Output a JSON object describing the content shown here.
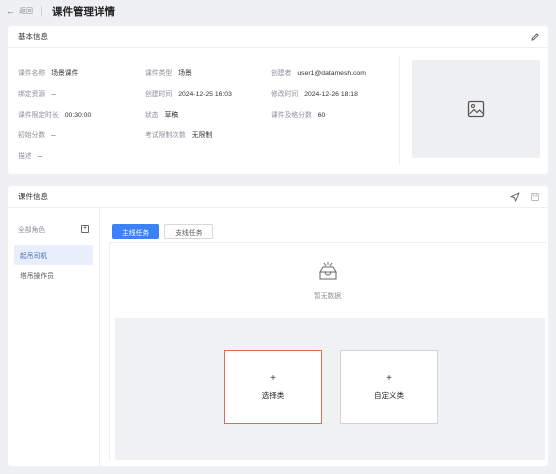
{
  "header": {
    "back_label": "返回",
    "title": "课件管理详情"
  },
  "basic": {
    "title": "基本信息",
    "fields": {
      "name": {
        "k": "课件名称",
        "v": "场景课件"
      },
      "type": {
        "k": "课件类型",
        "v": "场景"
      },
      "creator": {
        "k": "创建者",
        "v": "user1@datamesh.com"
      },
      "bind": {
        "k": "绑定资源",
        "v": "--"
      },
      "created": {
        "k": "创建时间",
        "v": "2024-12-25 16:03"
      },
      "modified": {
        "k": "修改时间",
        "v": "2024-12-26 18:18"
      },
      "duration": {
        "k": "课件限定时长",
        "v": "00:30:00"
      },
      "status": {
        "k": "状态",
        "v": "草稿"
      },
      "pass": {
        "k": "课件及格分数",
        "v": "60"
      },
      "init": {
        "k": "初始分数",
        "v": "--"
      },
      "limit": {
        "k": "考试限制次数",
        "v": "无限制"
      },
      "desc": {
        "k": "描述",
        "v": "--"
      }
    }
  },
  "course": {
    "title": "课件信息",
    "roles_label": "全部角色",
    "roles": [
      "起吊司机",
      "塔吊操作员"
    ],
    "tabs": [
      "主线任务",
      "支线任务"
    ],
    "empty_text": "暂无数据",
    "choices": {
      "select": "选择类",
      "custom": "自定义类",
      "plus": "+"
    }
  },
  "colors": {
    "accent": "#3b82f6",
    "selected_border": "#e06a5a"
  }
}
